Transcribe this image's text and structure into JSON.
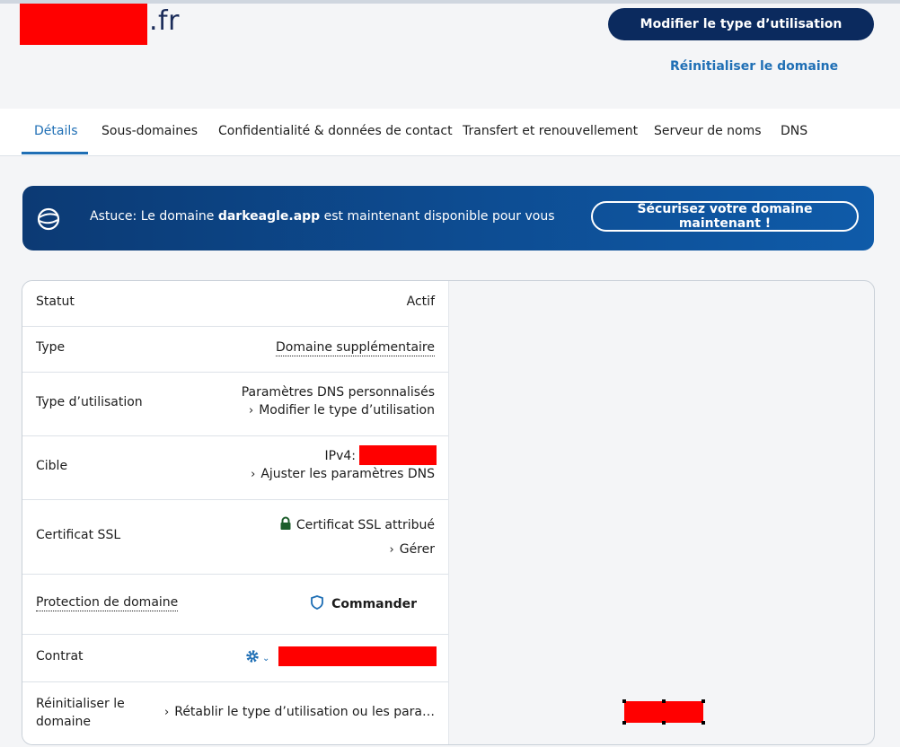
{
  "header": {
    "domain_suffix": ".fr",
    "primary_button": "Modifier le type d’utilisation",
    "reset_link": "Réinitialiser le domaine"
  },
  "tabs": [
    {
      "label": "Détails",
      "active": true
    },
    {
      "label": "Sous-domaines"
    },
    {
      "label": "Confidentialité & données de contact"
    },
    {
      "label": "Transfert et renouvellement"
    },
    {
      "label": "Serveur de noms"
    },
    {
      "label": "DNS"
    }
  ],
  "tip": {
    "prefix": "Astuce: Le domaine ",
    "domain": "darkeagle.app",
    "suffix": " est maintenant disponible pour vous",
    "button": "Sécurisez votre domaine maintenant !"
  },
  "details": {
    "status": {
      "label": "Statut",
      "value": "Actif"
    },
    "type": {
      "label": "Type",
      "value": "Domaine supplémentaire"
    },
    "usage": {
      "label": "Type d’utilisation",
      "value": "Paramètres DNS personnalisés",
      "link": "Modifier le type d’utilisation"
    },
    "target": {
      "label": "Cible",
      "value_prefix": "IPv4:",
      "link": "Ajuster les paramètres DNS"
    },
    "ssl": {
      "label": "Certificat SSL",
      "value": "Certificat SSL attribué",
      "link": "Gérer"
    },
    "protection": {
      "label": "Protection de domaine",
      "button": "Commander"
    },
    "contract": {
      "label": "Contrat"
    },
    "reset": {
      "label_line1": "Réinitialiser le",
      "label_line2": "domaine",
      "link": "Rétablir le type d’utilisation ou les para…"
    }
  },
  "colors": {
    "accent": "#1f6fb5",
    "navy": "#0b2a5e",
    "success": "#1c5d2b",
    "redaction": "#ff0000"
  }
}
